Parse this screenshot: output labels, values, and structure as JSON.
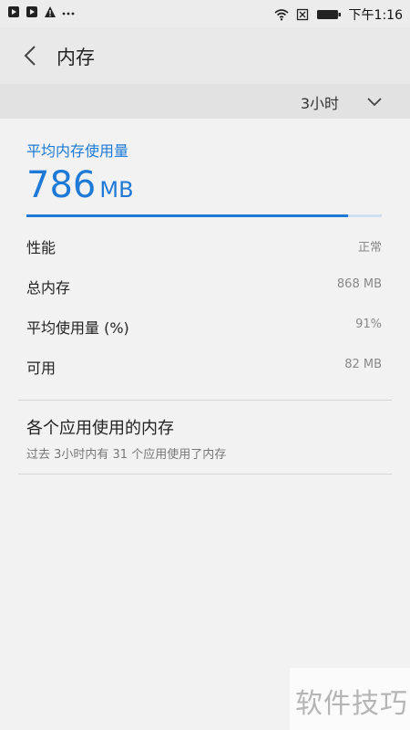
{
  "status_bar": {
    "time": "下午1:16",
    "left_icons": [
      "play-icon",
      "play-icon",
      "warning-icon",
      "more-dots-icon"
    ],
    "right_icons": [
      "wifi-icon",
      "no-sim-icon",
      "battery-icon"
    ]
  },
  "header": {
    "title": "内存"
  },
  "range": {
    "label": "3小时"
  },
  "average": {
    "label": "平均内存使用量",
    "value": "786",
    "unit": "MB",
    "fill_fraction": 0.905
  },
  "stats": [
    {
      "label": "性能",
      "value": "正常"
    },
    {
      "label": "总内存",
      "value": "868 MB"
    },
    {
      "label": "平均使用量 (%)",
      "value": "91%"
    },
    {
      "label": "可用",
      "value": "82 MB"
    }
  ],
  "apps": {
    "title": "各个应用使用的内存",
    "subtitle": "过去 3小时内有 31 个应用使用了内存"
  },
  "watermark": {
    "text": "软件技巧"
  },
  "colors": {
    "accent": "#1e7ad6",
    "background": "#f2f2f2",
    "header": "#e9e9e9"
  }
}
